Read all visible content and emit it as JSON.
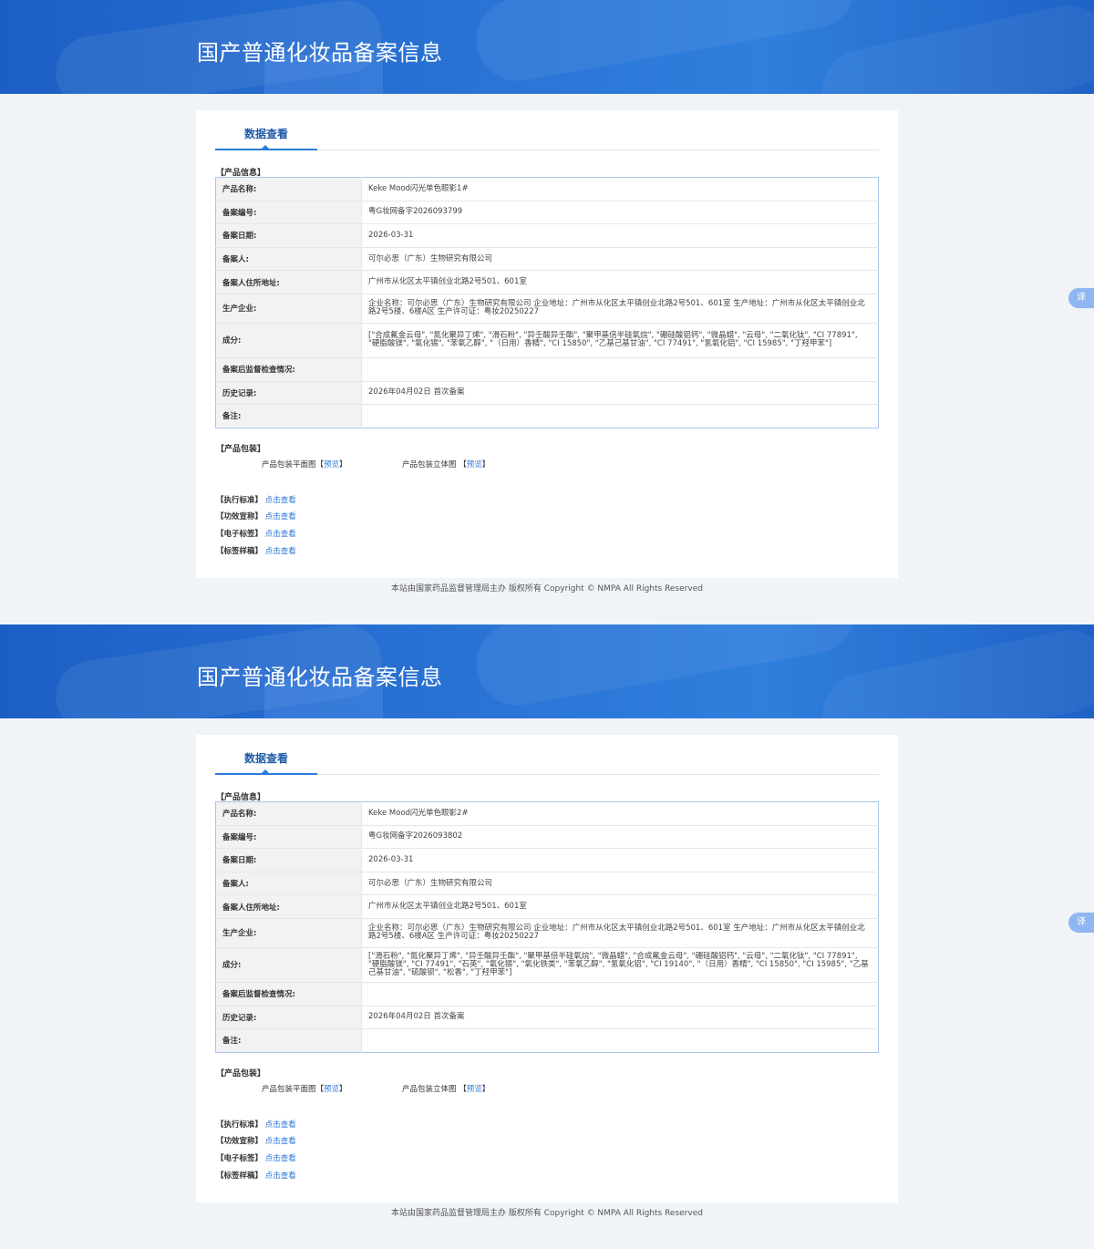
{
  "banner_title": "国产普通化妆品备案信息",
  "tab_label": "数据查看",
  "section_product_info": "【产品信息】",
  "section_packaging": "【产品包装】",
  "pkg_flat_label": "产品包装平面图",
  "pkg_3d_label": "产品包装立体图",
  "preview_label": "预览",
  "bracket_left": "【",
  "bracket_right": "】",
  "links": [
    {
      "label": "【执行标准】",
      "action": "点击查看"
    },
    {
      "label": "【功效宣称】",
      "action": "点击查看"
    },
    {
      "label": "【电子标签】",
      "action": "点击查看"
    },
    {
      "label": "【标签样稿】",
      "action": "点击查看"
    }
  ],
  "footer": "本站由国家药品监督管理局主办 版权所有 Copyright © NMPA All Rights Reserved",
  "translate_button": "译",
  "field_labels": {
    "name": "产品名称:",
    "reg_no": "备案编号:",
    "reg_date": "备案日期:",
    "registrant": "备案人:",
    "address": "备案人住所地址:",
    "manufacturer": "生产企业:",
    "ingredients": "成分:",
    "inspection": "备案后监督检查情况:",
    "history": "历史记录:",
    "remark": "备注:"
  },
  "records": [
    {
      "name": "Keke Mood闪光单色眼影1#",
      "reg_no": "粤G妆网备字2026093799",
      "reg_date": "2026-03-31",
      "registrant": "可尔必思（广东）生物研究有限公司",
      "address": "广州市从化区太平镇创业北路2号501、601室",
      "manufacturer": "企业名称：可尔必思（广东）生物研究有限公司 企业地址：广州市从化区太平镇创业北路2号501、601室 生产地址：广州市从化区太平镇创业北路2号5楼、6楼A区 生产许可证：粤妆20250227",
      "ingredients": "[\"合成氟金云母\", \"氮化聚异丁烯\", \"滑石粉\", \"异壬酸异壬酯\", \"聚甲基倍半硅氧烷\", \"硼硅酸铝钙\", \"微晶蜡\", \"云母\", \"二氧化钛\", \"CI 77891\", \"硬脂酸镁\", \"氧化锡\", \"苯氧乙醇\", \"（日用）香精\", \"CI 15850\", \"乙基己基甘油\", \"CI 77491\", \"氢氧化铝\", \"CI 15985\", \"丁羟甲苯\"]",
      "inspection": "",
      "history": "2026年04月02日 首次备案",
      "remark": ""
    },
    {
      "name": "Keke Mood闪光单色眼影2#",
      "reg_no": "粤G妆网备字2026093802",
      "reg_date": "2026-03-31",
      "registrant": "可尔必思（广东）生物研究有限公司",
      "address": "广州市从化区太平镇创业北路2号501、601室",
      "manufacturer": "企业名称：可尔必思（广东）生物研究有限公司 企业地址：广州市从化区太平镇创业北路2号501、601室 生产地址：广州市从化区太平镇创业北路2号5楼、6楼A区 生产许可证：粤妆20250227",
      "ingredients": "[\"滑石粉\", \"氮化聚异丁烯\", \"异壬酸异壬酯\", \"聚甲基倍半硅氧烷\", \"微晶蜡\", \"合成氟金云母\", \"硼硅酸铝钙\", \"云母\", \"二氧化钛\", \"CI 77891\", \"硬脂酸镁\", \"CI 77491\", \"石英\", \"氧化锡\", \"氧化铁类\", \"苯氧乙醇\", \"氢氧化铝\", \"CI 19140\", \"（日用）香精\", \"CI 15850\", \"CI 15985\", \"乙基己基甘油\", \"硫酸钡\", \"松香\", \"丁羟甲苯\"]",
      "inspection": "",
      "history": "2026年04月02日 首次备案",
      "remark": ""
    }
  ],
  "colors": {
    "banner": "#2a74d6",
    "accent": "#2a7cd6",
    "page_bg": "#f0f3f7"
  }
}
